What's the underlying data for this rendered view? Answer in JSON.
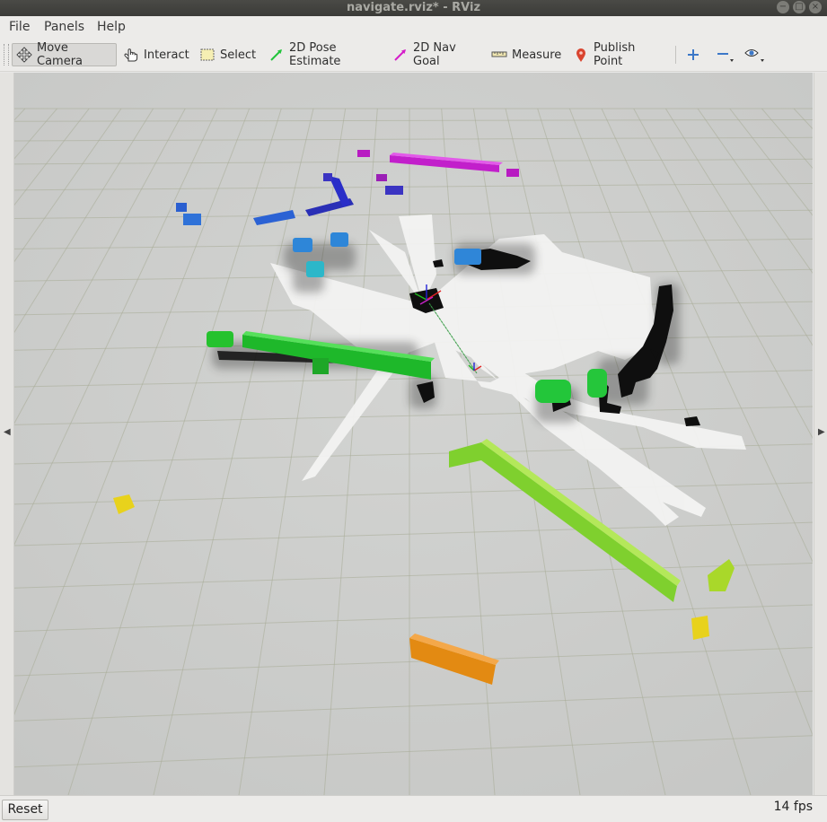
{
  "window": {
    "title": "navigate.rviz* - RViz"
  },
  "menu": {
    "file": "File",
    "panels": "Panels",
    "help": "Help"
  },
  "toolbar": {
    "move_camera": "Move Camera",
    "interact": "Interact",
    "select": "Select",
    "pose_estimate": "2D Pose Estimate",
    "nav_goal": "2D Nav Goal",
    "measure": "Measure",
    "publish_point": "Publish Point"
  },
  "status": {
    "reset": "Reset",
    "fps": "14 fps"
  },
  "colors": {
    "grid_line": "#a8ac97",
    "ground": "#c9cac8",
    "free_space": "#f2f2f2",
    "obstacle": "#111111"
  }
}
